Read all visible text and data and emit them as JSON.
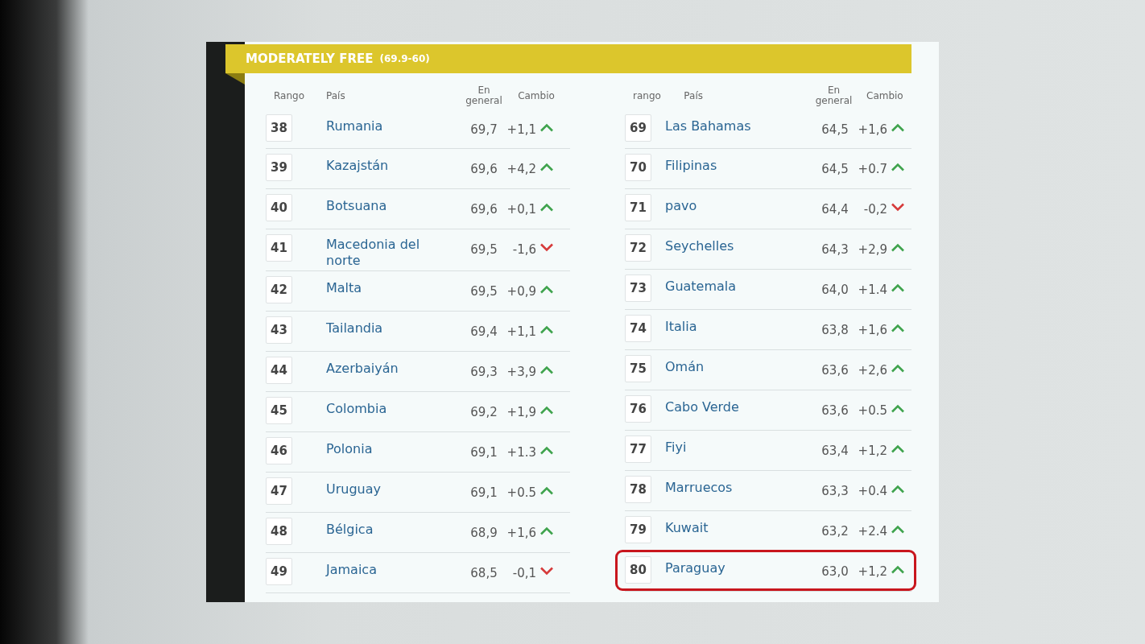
{
  "banner": {
    "title": "MODERATELY FREE",
    "range": "(69.9-60)"
  },
  "tables": [
    {
      "columns": [
        "Rango",
        "País",
        "En general",
        "Cambio"
      ],
      "rows": [
        {
          "rank": "38",
          "country": "Rumania",
          "score": "69,7",
          "change": "+1,1",
          "kind": "up",
          "highlighted": false
        },
        {
          "rank": "39",
          "country": "Kazajstán",
          "score": "69,6",
          "change": "+4,2",
          "kind": "up",
          "highlighted": false
        },
        {
          "rank": "40",
          "country": "Botsuana",
          "score": "69,6",
          "change": "+0,1",
          "kind": "up",
          "highlighted": false
        },
        {
          "rank": "41",
          "country": "Macedonia del norte",
          "score": "69,5",
          "change": "-1,6",
          "kind": "down",
          "highlighted": false
        },
        {
          "rank": "42",
          "country": "Malta",
          "score": "69,5",
          "change": "+0,9",
          "kind": "up",
          "highlighted": false
        },
        {
          "rank": "43",
          "country": "Tailandia",
          "score": "69,4",
          "change": "+1,1",
          "kind": "up",
          "highlighted": false
        },
        {
          "rank": "44",
          "country": "Azerbaiyán",
          "score": "69,3",
          "change": "+3,9",
          "kind": "up",
          "highlighted": false
        },
        {
          "rank": "45",
          "country": "Colombia",
          "score": "69,2",
          "change": "+1,9",
          "kind": "up",
          "highlighted": false
        },
        {
          "rank": "46",
          "country": "Polonia",
          "score": "69,1",
          "change": "+1.3",
          "kind": "up",
          "highlighted": false
        },
        {
          "rank": "47",
          "country": "Uruguay",
          "score": "69,1",
          "change": "+0.5",
          "kind": "up",
          "highlighted": false
        },
        {
          "rank": "48",
          "country": "Bélgica",
          "score": "68,9",
          "change": "+1,6",
          "kind": "up",
          "highlighted": false
        },
        {
          "rank": "49",
          "country": "Jamaica",
          "score": "68,5",
          "change": "-0,1",
          "kind": "down",
          "highlighted": false
        }
      ]
    },
    {
      "columns": [
        "rango",
        "País",
        "En general",
        "Cambio"
      ],
      "rows": [
        {
          "rank": "69",
          "country": "Las Bahamas",
          "score": "64,5",
          "change": "+1,6",
          "kind": "up",
          "highlighted": false
        },
        {
          "rank": "70",
          "country": "Filipinas",
          "score": "64,5",
          "change": "+0.7",
          "kind": "up",
          "highlighted": false
        },
        {
          "rank": "71",
          "country": "pavo",
          "score": "64,4",
          "change": "-0,2",
          "kind": "down",
          "highlighted": false
        },
        {
          "rank": "72",
          "country": "Seychelles",
          "score": "64,3",
          "change": "+2,9",
          "kind": "up",
          "highlighted": false
        },
        {
          "rank": "73",
          "country": "Guatemala",
          "score": "64,0",
          "change": "+1.4",
          "kind": "up",
          "highlighted": false
        },
        {
          "rank": "74",
          "country": "Italia",
          "score": "63,8",
          "change": "+1,6",
          "kind": "up",
          "highlighted": false
        },
        {
          "rank": "75",
          "country": "Omán",
          "score": "63,6",
          "change": "+2,6",
          "kind": "up",
          "highlighted": false
        },
        {
          "rank": "76",
          "country": "Cabo Verde",
          "score": "63,6",
          "change": "+0.5",
          "kind": "up",
          "highlighted": false
        },
        {
          "rank": "77",
          "country": "Fiyi",
          "score": "63,4",
          "change": "+1,2",
          "kind": "up",
          "highlighted": false
        },
        {
          "rank": "78",
          "country": "Marruecos",
          "score": "63,3",
          "change": "+0.4",
          "kind": "up",
          "highlighted": false
        },
        {
          "rank": "79",
          "country": "Kuwait",
          "score": "63,2",
          "change": "+2.4",
          "kind": "up",
          "highlighted": false
        },
        {
          "rank": "80",
          "country": "Paraguay",
          "score": "63,0",
          "change": "+1,2",
          "kind": "up",
          "highlighted": true
        }
      ]
    }
  ]
}
